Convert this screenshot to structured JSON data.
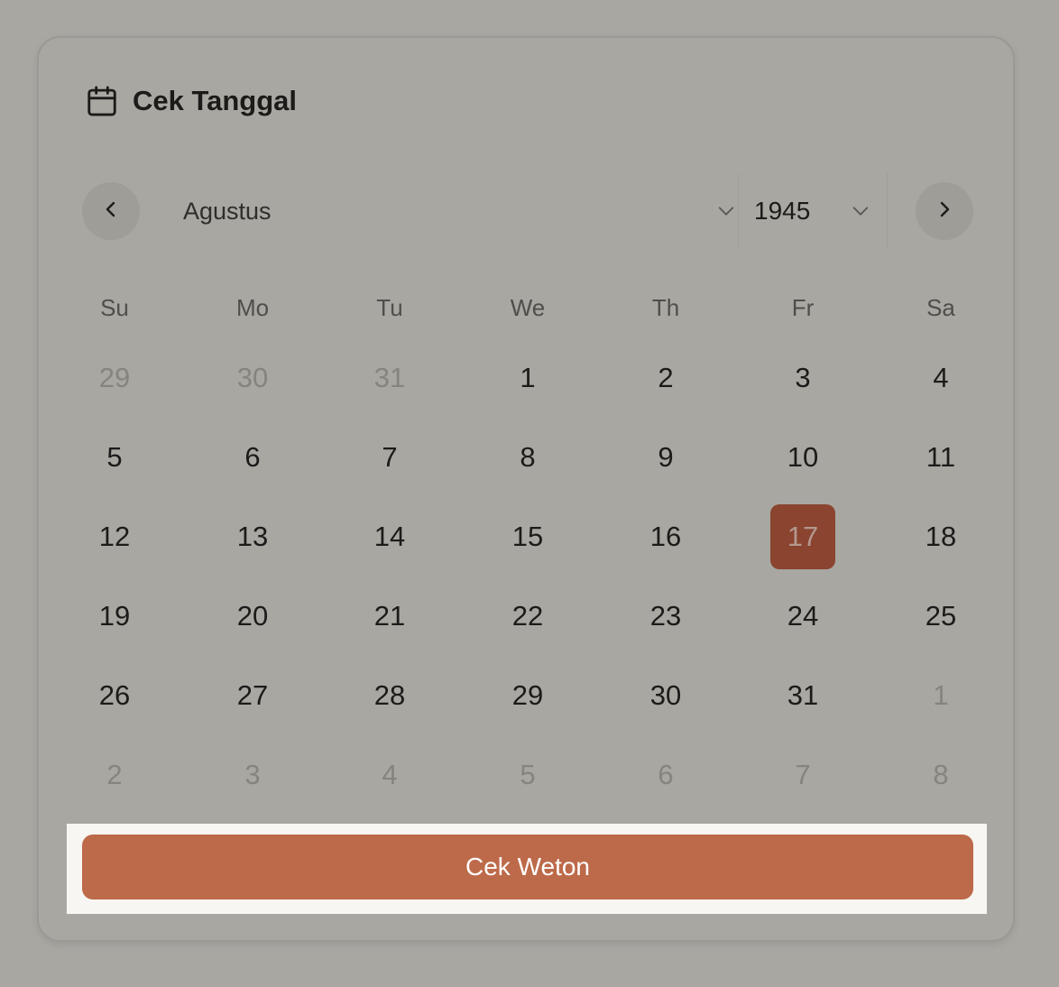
{
  "header": {
    "icon": "calendar-icon",
    "title": "Cek Tanggal"
  },
  "navigation": {
    "prev_icon": "chevron-left-icon",
    "next_icon": "chevron-right-icon",
    "month": "Agustus",
    "year": "1945"
  },
  "weekdays": [
    "Su",
    "Mo",
    "Tu",
    "We",
    "Th",
    "Fr",
    "Sa"
  ],
  "weeks": [
    [
      {
        "label": "29",
        "outside": true
      },
      {
        "label": "30",
        "outside": true
      },
      {
        "label": "31",
        "outside": true
      },
      {
        "label": "1"
      },
      {
        "label": "2"
      },
      {
        "label": "3"
      },
      {
        "label": "4"
      }
    ],
    [
      {
        "label": "5"
      },
      {
        "label": "6"
      },
      {
        "label": "7"
      },
      {
        "label": "8"
      },
      {
        "label": "9"
      },
      {
        "label": "10"
      },
      {
        "label": "11"
      }
    ],
    [
      {
        "label": "12"
      },
      {
        "label": "13"
      },
      {
        "label": "14"
      },
      {
        "label": "15"
      },
      {
        "label": "16"
      },
      {
        "label": "17",
        "selected": true
      },
      {
        "label": "18"
      }
    ],
    [
      {
        "label": "19"
      },
      {
        "label": "20"
      },
      {
        "label": "21"
      },
      {
        "label": "22"
      },
      {
        "label": "23"
      },
      {
        "label": "24"
      },
      {
        "label": "25"
      }
    ],
    [
      {
        "label": "26"
      },
      {
        "label": "27"
      },
      {
        "label": "28"
      },
      {
        "label": "29"
      },
      {
        "label": "30"
      },
      {
        "label": "31"
      },
      {
        "label": "1",
        "outside": true
      }
    ],
    [
      {
        "label": "2",
        "outside": true
      },
      {
        "label": "3",
        "outside": true
      },
      {
        "label": "4",
        "outside": true
      },
      {
        "label": "5",
        "outside": true
      },
      {
        "label": "6",
        "outside": true
      },
      {
        "label": "7",
        "outside": true
      },
      {
        "label": "8",
        "outside": true
      }
    ]
  ],
  "action": {
    "label": "Cek Weton"
  },
  "colors": {
    "background": "#a8a7a2",
    "selected_day": "#8a4430",
    "button": "#bd6a4a",
    "button_highlight": "#f8f6f2"
  }
}
